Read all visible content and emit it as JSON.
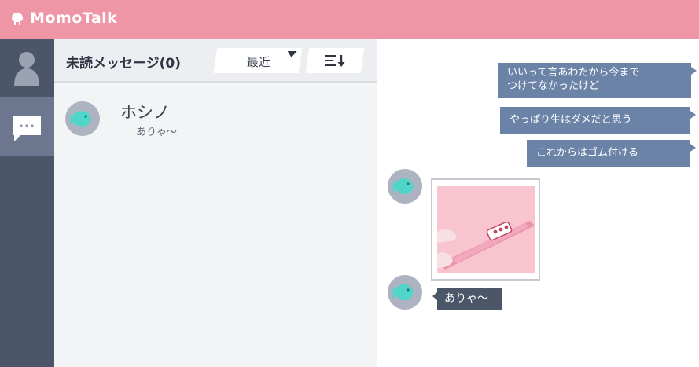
{
  "app": {
    "title": "MomoTalk",
    "accent_color": "#ef96a6",
    "sidebar_color": "#4b5669",
    "logo_icon": "halo-icon"
  },
  "sidebar": {
    "items": [
      {
        "icon": "person-icon",
        "active": false
      },
      {
        "icon": "chat-bubble-icon",
        "active": true
      }
    ]
  },
  "list": {
    "unread_label": "未読メッセージ(0)",
    "sort": {
      "selected": "最近"
    },
    "order_icon": "sort-order-icon",
    "contacts": [
      {
        "name": "ホシノ",
        "preview": "ありゃ〜",
        "avatar_icon": "fish-icon"
      }
    ]
  },
  "chat": {
    "messages": [
      {
        "from": "me",
        "type": "text",
        "lines": [
          "いいって言あわたから今まで",
          "つけてなかったけど"
        ]
      },
      {
        "from": "me",
        "type": "text",
        "text": "やっぱり生はダメだと思う"
      },
      {
        "from": "me",
        "type": "text",
        "text": "これからはゴム付ける"
      },
      {
        "from": "ホシノ",
        "type": "image",
        "description_icon": "image-photo-icon"
      },
      {
        "from": "ホシノ",
        "type": "text",
        "text": "ありゃ〜"
      }
    ]
  }
}
